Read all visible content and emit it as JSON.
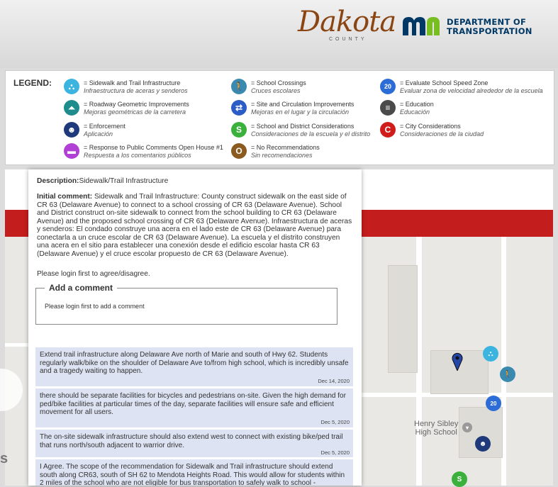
{
  "header": {
    "dakota_logo_text": "Dakota",
    "dakota_county_text": "COUNTY",
    "mndot_line1": "DEPARTMENT OF",
    "mndot_line2": "TRANSPORTATION"
  },
  "legend": {
    "title": "LEGEND:",
    "items": [
      {
        "en": "= Sidewalk and Trail Infrastructure",
        "es": "Infraestructura de aceras y senderos",
        "icon": "sidewalk-trail-icon",
        "color": "#3bb4e0"
      },
      {
        "en": "= Roadway Geometric Improvements",
        "es": "Mejoras geométricas de la carretera",
        "icon": "roadway-icon",
        "color": "#1e8c8c"
      },
      {
        "en": "= Enforcement",
        "es": "Aplicación",
        "icon": "police-icon",
        "color": "#1f3a7a"
      },
      {
        "en": "= Response to Public Comments Open House #1",
        "es": "Respuesta a los comentarios públicos",
        "icon": "chat-bubble-icon",
        "color": "#b23fd6"
      },
      {
        "en": "= School Crossings",
        "es": "Cruces escolares",
        "icon": "pedestrian-icon",
        "color": "#3a8ab0"
      },
      {
        "en": "= Site and Circulation Improvements",
        "es": "Mejoras en el lugar y la circulación",
        "icon": "circulation-icon",
        "color": "#2c5cc6"
      },
      {
        "en": "= School and District Considerations",
        "es": "Consideraciones de la escuela y el distrito",
        "icon": "school-s-icon",
        "color": "#3cb03c"
      },
      {
        "en": "= No Recommendations",
        "es": "Sin recomendaciones",
        "icon": "no-recommendation-icon",
        "color": "#8a5a1e"
      },
      {
        "en": "= Evaluate School Speed Zone",
        "es": "Evaluar zona de velocidad alrededor de la escuela",
        "icon": "speed-20-icon",
        "color": "#2c6cd6",
        "glyph": "20"
      },
      {
        "en": "= Education",
        "es": "Educación",
        "icon": "education-book-icon",
        "color": "#4a4a4a"
      },
      {
        "en": "= City Considerations",
        "es": "Consideraciones de la ciudad",
        "icon": "city-c-icon",
        "color": "#d11c1c"
      }
    ]
  },
  "popup": {
    "description_label": "Description:",
    "description_value": "Sidewalk/Trail Infrastructure",
    "initial_label": "Initial comment:",
    "initial_text": " Sidewalk and Trail Infrastructure: County construct sidewalk on the east side of CR 63 (Delaware Avenue) to connect to a school crossing of CR 63 (Delaware Avenue). School and District construct on-site sidewalk to connect from the school building to CR 63 (Delaware Avenue) and the proposed school crossing of CR 63 (Delaware Avenue). Infraestructura de aceras y senderos: El condado construye una acera en el lado este de CR 63 (Delaware Avenue) para conectarla a un cruce escolar de CR 63 (Delaware Avenue). La escuela y el distrito construyen una acera en el sitio para establecer una conexión desde el edificio escolar hasta CR 63 (Delaware Avenue) y el cruce escolar propuesto de CR 63 (Delaware Avenue).",
    "login_agree": "Please login first to agree/disagree.",
    "add_comment_title": "Add a comment",
    "add_comment_login": "Please login first to add a comment",
    "comments": [
      {
        "text": "Extend trail infrastructure along Delaware Ave north of Marie and south of Hwy 62. Students regularly walk/bike on the shoulder of Delaware Ave to/from high school, which is incredibly unsafe and a tragedy waiting to happen.",
        "date": "Dec 14, 2020"
      },
      {
        "text": "there should be separate facilities for bicycles and pedestrians on-site. Given the high demand for ped/bike facilities at particular times of the day, separate facilities will ensure safe and efficient movement for all users.",
        "date": "Dec 5, 2020"
      },
      {
        "text": "The on-site sidewalk infrastructure should also extend west to connect with existing bike/ped trail that runs north/south adjacent to warrior drive.",
        "date": "Dec 5, 2020"
      },
      {
        "text": "I Agree. The scope of the recommendation for Sidewalk and Trail infrastructure should extend south along CR63, south of SH 62 to Mendota Heights Road. This would allow for students within 2 miles of the school who are not eligible for bus transportation to safely walk to school -",
        "date": ""
      }
    ]
  },
  "map": {
    "school_label_line1": "Henry Sibley",
    "school_label_line2": "High School",
    "left_edge_letter": "s"
  }
}
